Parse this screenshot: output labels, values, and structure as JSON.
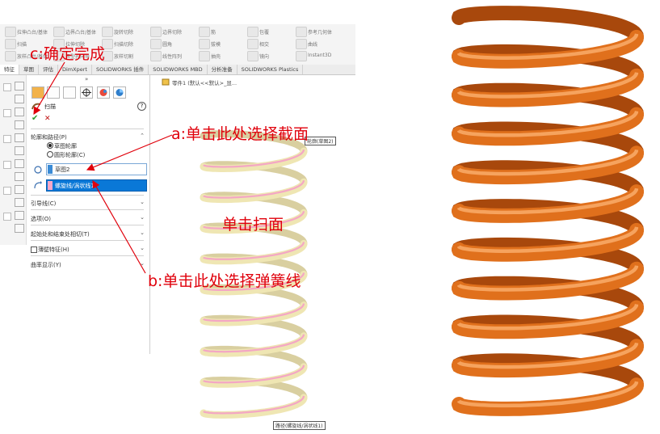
{
  "ribbon": {
    "buttons": [
      {
        "icon": "extrude-boss-icon",
        "label": "拉伸凸台/基体"
      },
      {
        "icon": "sweep-boss-icon",
        "label": "扫描"
      },
      {
        "icon": "loft-boss-icon",
        "label": "放样凸台/基体"
      },
      {
        "icon": "boundary-boss-icon",
        "label": "边界凸台/基体"
      },
      {
        "icon": "extrude-cut-icon",
        "label": "拉伸切除"
      },
      {
        "icon": "hole-wizard-icon",
        "label": "异型孔向导"
      },
      {
        "icon": "revolve-cut-icon",
        "label": "旋转切除"
      },
      {
        "icon": "sweep-cut-icon",
        "label": "扫描切除"
      },
      {
        "icon": "loft-cut-icon",
        "label": "放样切割"
      },
      {
        "icon": "boundary-cut-icon",
        "label": "边界切除"
      },
      {
        "icon": "fillet-icon",
        "label": "圆角"
      },
      {
        "icon": "linear-pattern-icon",
        "label": "线性阵列"
      },
      {
        "icon": "rib-icon",
        "label": "筋"
      },
      {
        "icon": "draft-icon",
        "label": "拔模"
      },
      {
        "icon": "shell-icon",
        "label": "抽壳"
      },
      {
        "icon": "wrap-icon",
        "label": "包覆"
      },
      {
        "icon": "intersect-icon",
        "label": "相交"
      },
      {
        "icon": "mirror-icon",
        "label": "镜向"
      },
      {
        "icon": "reference-geometry-icon",
        "label": "参考几何体"
      },
      {
        "icon": "curves-icon",
        "label": "曲线"
      },
      {
        "icon": "instant3d-icon",
        "label": "Instant3D"
      }
    ]
  },
  "tabs": [
    "特征",
    "草图",
    "评估",
    "DimXpert",
    "SOLIDWORKS 插件",
    "SOLIDWORKS MBD",
    "分析准备",
    "SOLIDWORKS Plastics"
  ],
  "breadcrumb": "零件1 (默认<<默认>_显...",
  "property_manager": {
    "title": "扫描",
    "ok_symbol": "✔",
    "cancel_symbol": "✕",
    "help_symbol": "?",
    "section_profile": "轮廓和路径(P)",
    "radio_sketch_profile": "草图轮廓",
    "radio_circular_profile": "圆形轮廓(C)",
    "profile_value": "草图2",
    "path_value": "螺旋线/涡状线1",
    "section_guides": "引导线(C)",
    "section_options": "选项(O)",
    "section_start_end": "起始处和结束处相切(T)",
    "section_thin": "薄壁特征(H)",
    "section_curvature": "曲率显示(Y)"
  },
  "viewport": {
    "tooltip_profile": "轮廓(草图2)",
    "tooltip_path": "路径(螺旋线/涡状线1)"
  },
  "annotations": {
    "a": "a:单击此处选择截面",
    "b": "b:单击此处选择弹簧线",
    "c": "c:确定完成",
    "sweep": "单击扫面"
  },
  "colors": {
    "annotation_red": "#e0000b",
    "spring_orange": "#e0701c",
    "selection_blue": "#0a78d7",
    "path_pink": "#f7b6cf"
  }
}
